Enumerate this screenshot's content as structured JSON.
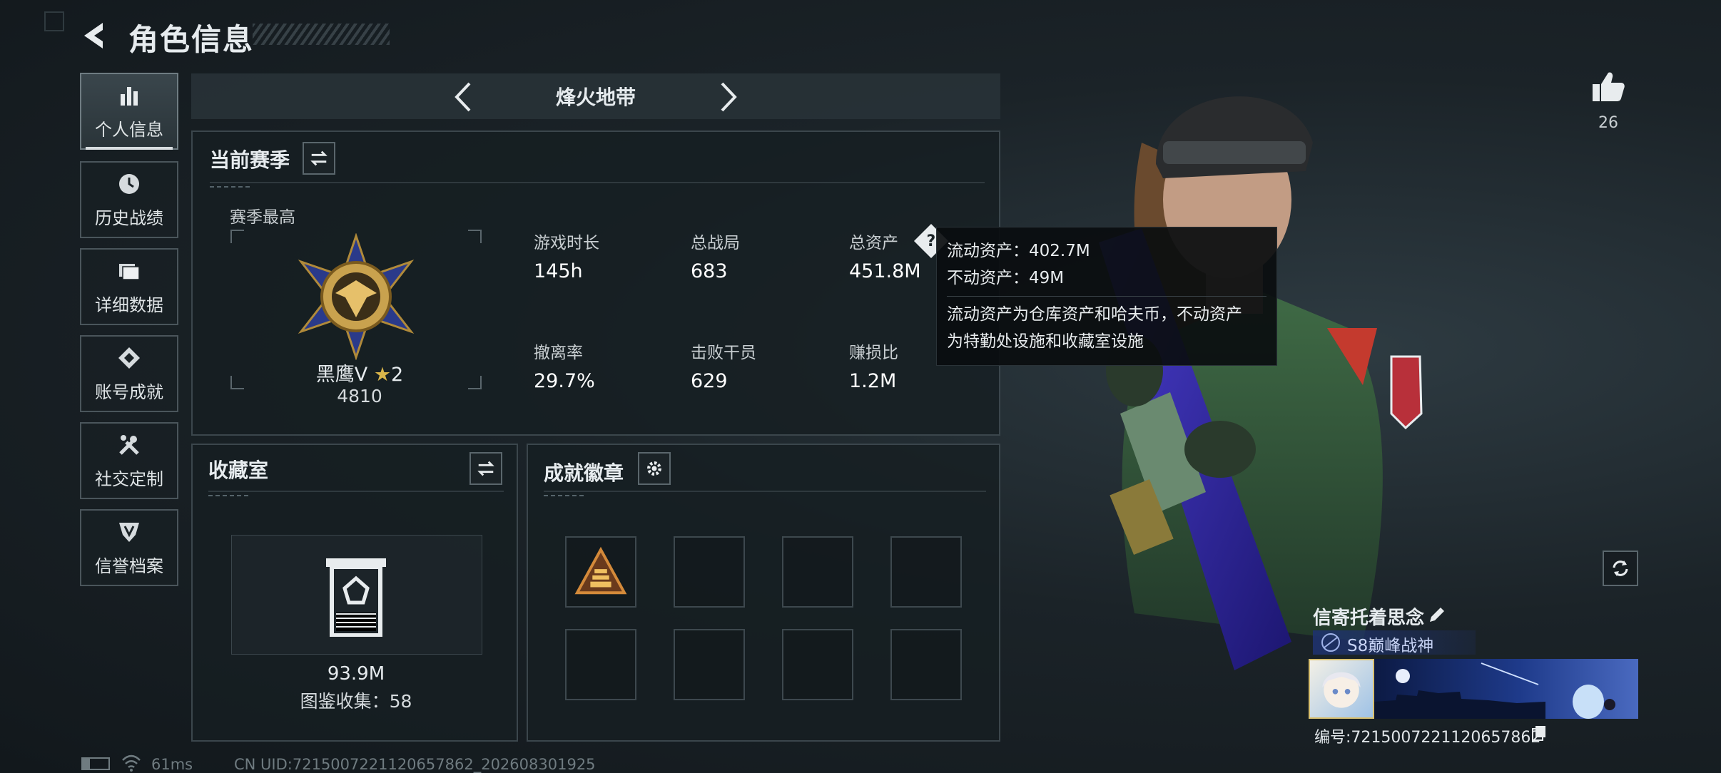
{
  "header": {
    "title": "角色信息"
  },
  "sidebar": {
    "items": [
      {
        "label": "个人信息",
        "icon": "bar-chart-icon",
        "active": true
      },
      {
        "label": "历史战绩",
        "icon": "history-icon",
        "active": false
      },
      {
        "label": "详细数据",
        "icon": "folder-icon",
        "active": false
      },
      {
        "label": "账号成就",
        "icon": "achievement-icon",
        "active": false
      },
      {
        "label": "社交定制",
        "icon": "tools-icon",
        "active": false
      },
      {
        "label": "信誉档案",
        "icon": "shield-icon",
        "active": false
      }
    ]
  },
  "mode": {
    "title": "烽火地带"
  },
  "season": {
    "title": "当前赛季",
    "best_label": "赛季最高",
    "rank_name": "黑鹰V",
    "rank_stars": "2",
    "rank_score": "4810",
    "stats": [
      {
        "label": "游戏时长",
        "value": "145h"
      },
      {
        "label": "总战局",
        "value": "683"
      },
      {
        "label": "总资产",
        "value": "451.8M"
      },
      {
        "label": "撤离率",
        "value": "29.7%"
      },
      {
        "label": "击败干员",
        "value": "629"
      },
      {
        "label": "赚损比",
        "value": "1.2M"
      }
    ]
  },
  "tooltip": {
    "liquid": "流动资产：402.7M",
    "fixed": "不动资产：49M",
    "desc_line1": "流动资产为仓库资产和哈夫币，不动资产",
    "desc_line2": "为特勤处设施和收藏室设施"
  },
  "collection": {
    "title": "收藏室",
    "value": "93.9M",
    "catalog": "图鉴收集：58"
  },
  "badges": {
    "title": "成就徽章",
    "slots": 8
  },
  "profile": {
    "likes": "26",
    "name": "信寄托着思念",
    "rank_title": "S8巅峰战神",
    "id_text": "编号:7215007221120657862"
  },
  "footer": {
    "ping": "61ms",
    "uid": "CN UID:7215007221120657862_202608301925"
  },
  "colors": {
    "accent": "#d8dde0",
    "panel": "#161e22",
    "rank_blue": "#1e326e"
  }
}
